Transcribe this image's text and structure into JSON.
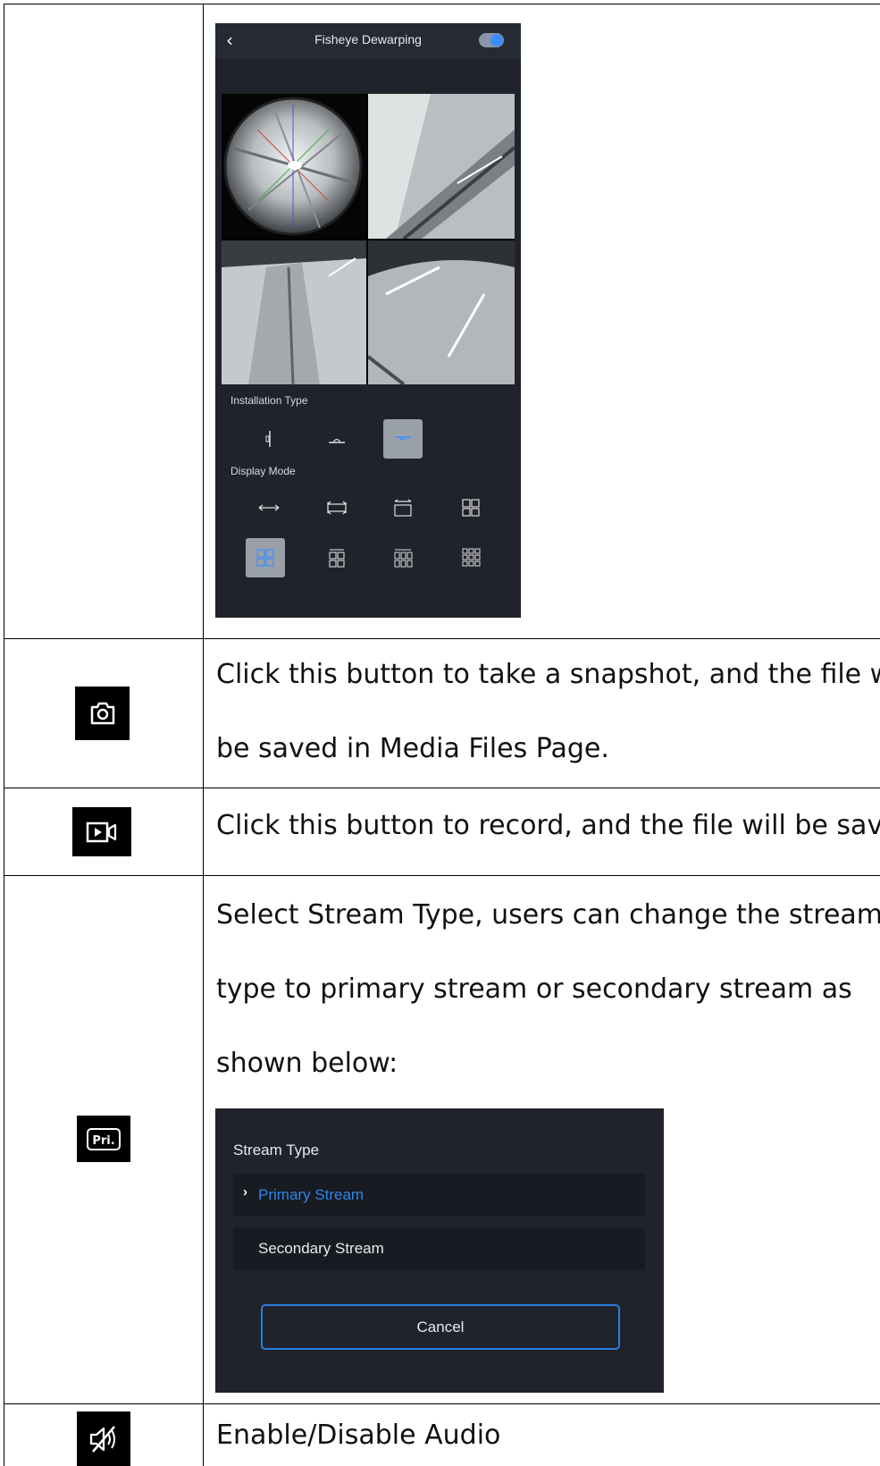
{
  "app": {
    "header": {
      "title": "Fisheye Dewarping",
      "back_glyph": "‹"
    },
    "installation_label": "Installation Type",
    "display_label": "Display Mode",
    "installation_types": [
      "wall-mount-icon",
      "ceiling-mount-icon",
      "desktop-mount-icon"
    ],
    "installation_selected_index": 2,
    "display_modes": [
      "1P",
      "2P",
      "1O+1P",
      "4R",
      "1O+3R",
      "1O+2P+... ",
      "1O+4R",
      "1O+8R"
    ],
    "display_selected_index": 4,
    "toggle_on": true,
    "accent": "#3d8dff"
  },
  "rows": {
    "snapshot": {
      "icon": "camera-icon",
      "line1": "Click this button to take a snapshot, and the file will",
      "line2": "be saved in Media Files Page."
    },
    "record": {
      "icon": "video-record-icon",
      "line1": "Click this button to record, and the file will be saved"
    },
    "stream": {
      "icon": "pri-stream-icon",
      "icon_text": "Pri.",
      "line1": "Select Stream Type, users can change the stream",
      "line2": "type to primary stream or secondary stream as",
      "line3": "shown below:"
    },
    "audio": {
      "icon": "mute-speaker-icon",
      "line1": "Enable/Disable Audio"
    }
  },
  "dialog": {
    "title": "Stream Type",
    "options": [
      "Primary Stream",
      "Secondary Stream"
    ],
    "selected_index": 0,
    "cancel": "Cancel",
    "selected_color": "#2f86e8"
  }
}
